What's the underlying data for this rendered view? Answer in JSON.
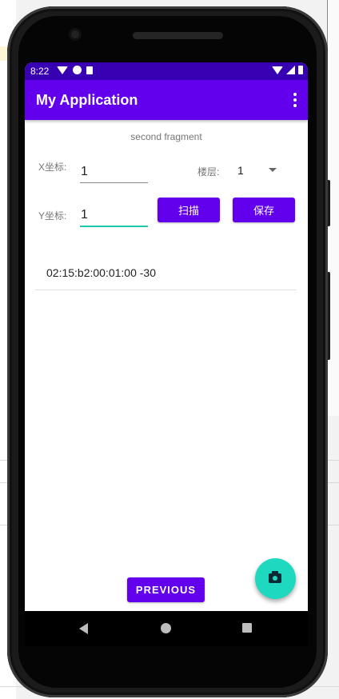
{
  "status_bar": {
    "time": "8:22",
    "left_icons": [
      "wifi-icon",
      "circle-icon",
      "sd-card-icon"
    ],
    "right_icons": [
      "wifi-icon",
      "signal-icon",
      "battery-icon"
    ]
  },
  "app_bar": {
    "title": "My Application",
    "menu_icon": "overflow-menu-icon",
    "color": "#6200ee"
  },
  "fragment": {
    "label": "second fragment"
  },
  "form": {
    "x_label": "X坐标:",
    "x_value": "1",
    "y_label": "Y坐标:",
    "y_value": "1",
    "floor_label": "楼层:",
    "floor_value": "1"
  },
  "buttons": {
    "scan": "扫描",
    "save": "保存",
    "previous": "PREVIOUS"
  },
  "list": {
    "items": [
      "02:15:b2:00:01:00 -30"
    ]
  },
  "fab": {
    "icon": "camera-icon",
    "color": "#1ed8c0"
  },
  "nav": {
    "icons": [
      "back-icon",
      "home-icon",
      "recents-icon"
    ]
  }
}
